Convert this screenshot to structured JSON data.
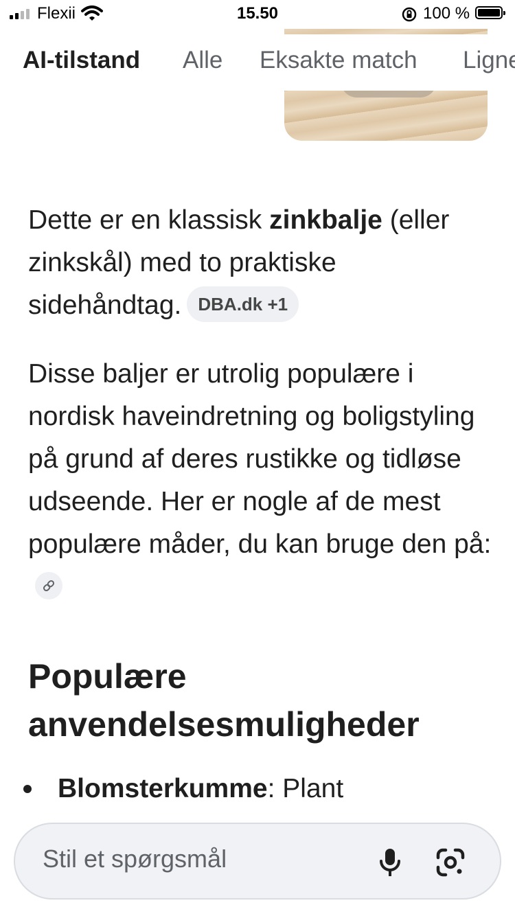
{
  "status_bar": {
    "carrier": "Flexii",
    "time": "15.50",
    "battery": "100 %"
  },
  "tabs": [
    {
      "label": "AI-tilstand",
      "active": true
    },
    {
      "label": "Alle",
      "active": false
    },
    {
      "label": "Eksakte match",
      "active": false
    },
    {
      "label": "Ligne",
      "active": false
    }
  ],
  "answer": {
    "p1_before": "Dette er en klassisk ",
    "p1_bold": "zinkbalje",
    "p1_after": " (eller zinkskål) med to praktiske sidehåndtag.",
    "source_chip": "DBA.dk +1",
    "p2": "Disse baljer er utrolig populære i nordisk haveindretning og boligstyling på grund af deres rustikke og tidløse udseende. Her er nogle af de mest populære måder, du kan bruge den på:",
    "heading": "Populære anvendelsesmuligheder",
    "bullet_bold": "Blomsterkumme",
    "bullet_rest": ": Plant"
  },
  "ask_bar": {
    "placeholder": "Stil et spørgsmål"
  },
  "icons": [
    "signal-icon",
    "wifi-icon",
    "orientation-lock-icon",
    "battery-icon",
    "link-icon",
    "microphone-icon",
    "google-lens-icon"
  ]
}
